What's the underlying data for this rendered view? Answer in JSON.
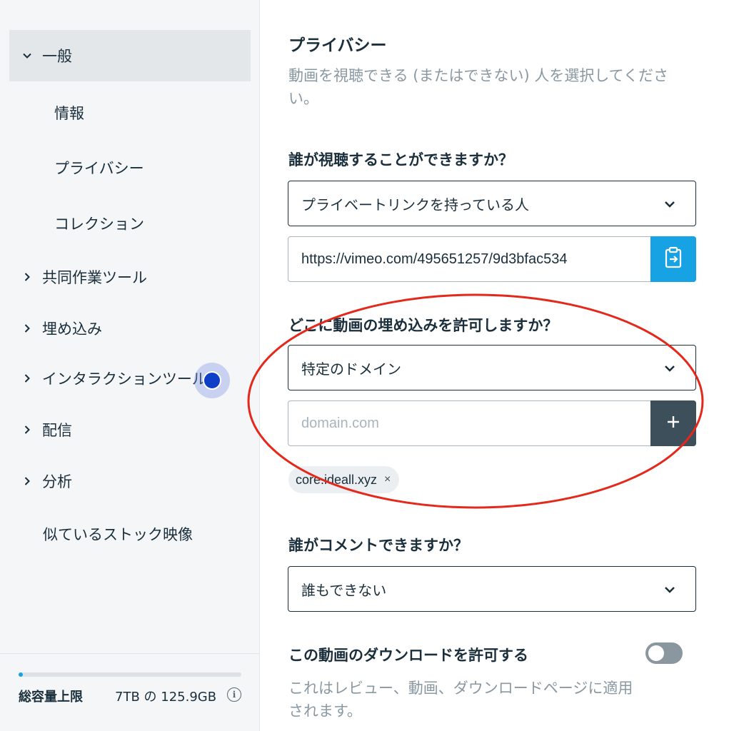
{
  "sidebar": {
    "items": [
      {
        "label": "一般"
      },
      {
        "label": "情報"
      },
      {
        "label": "プライバシー"
      },
      {
        "label": "コレクション"
      },
      {
        "label": "共同作業ツール"
      },
      {
        "label": "埋め込み"
      },
      {
        "label": "インタラクションツール"
      },
      {
        "label": "配信"
      },
      {
        "label": "分析"
      },
      {
        "label": "似ているストック映像"
      }
    ],
    "storage": {
      "label": "総容量上限",
      "value": "7TB の 125.9GB",
      "progress_fraction": 0.018
    }
  },
  "main": {
    "title": "プライバシー",
    "subtitle": "動画を視聴できる (またはできない) 人を選択してください。",
    "view_question": "誰が視聴することができますか？",
    "view_select": "プライベートリンクを持っている人",
    "link_value": "https://vimeo.com/495651257/9d3bfac534",
    "embed_question": "どこに動画の埋め込みを許可しますか？",
    "embed_select": "特定のドメイン",
    "domain_placeholder": "domain.com",
    "domain_chip": "core.ideall.xyz",
    "chip_remove": "×",
    "comment_question": "誰がコメントできますか？",
    "comment_select": "誰もできない",
    "download_label": "この動画のダウンロードを許可する",
    "download_desc": "これはレビュー、動画、ダウンロードページに適用されます。"
  },
  "colors": {
    "accent_blue": "#17a2e3",
    "dark_button": "#3c4f5a",
    "annotation_red": "#e4281b",
    "hotspot_blue": "#0d3fc7"
  }
}
